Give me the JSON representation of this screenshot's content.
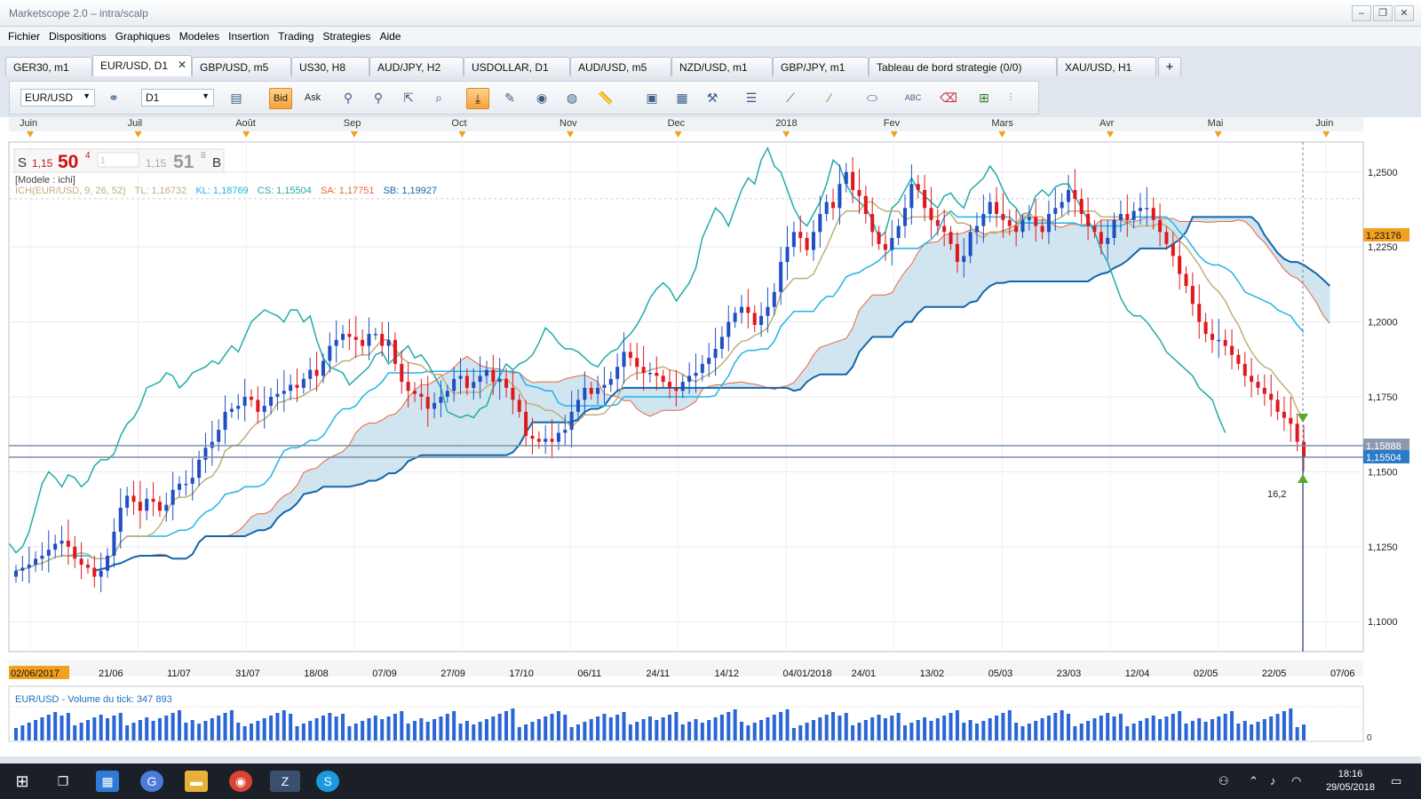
{
  "window": {
    "title": "Marketscope 2.0 – intra/scalp"
  },
  "menu": [
    "Fichier",
    "Dispositions",
    "Graphiques",
    "Modeles",
    "Insertion",
    "Trading",
    "Strategies",
    "Aide"
  ],
  "tabs": [
    {
      "label": "GER30, m1",
      "active": false
    },
    {
      "label": "EUR/USD, D1",
      "active": true
    },
    {
      "label": "GBP/USD, m5",
      "active": false
    },
    {
      "label": "US30, H8",
      "active": false
    },
    {
      "label": "AUD/JPY, H2",
      "active": false
    },
    {
      "label": "USDOLLAR, D1",
      "active": false
    },
    {
      "label": "AUD/USD, m5",
      "active": false
    },
    {
      "label": "NZD/USD, m1",
      "active": false
    },
    {
      "label": "GBP/JPY, m1",
      "active": false
    },
    {
      "label": "Tableau de bord strategie (0/0)",
      "active": false
    },
    {
      "label": "XAU/USD, H1",
      "active": false
    }
  ],
  "toolbar": {
    "symbol": "EUR/USD",
    "timeframe": "D1",
    "bid_label": "Bid",
    "ask_label": "Ask"
  },
  "quote": {
    "sell_letter": "S",
    "sell_prefix": "1,15",
    "sell_big": "50",
    "sell_sup": "4",
    "lots": "1",
    "buy_prefix": "1,15",
    "buy_big": "51",
    "buy_sup": "8",
    "buy_letter": "B"
  },
  "indicator": {
    "model": "[Modele : ichi]",
    "ich": "ICH(EUR/USD, 9, 26, 52)",
    "tl": "TL: 1,16732",
    "kl": "KL: 1,18769",
    "cs": "CS: 1,15504",
    "sa": "SA: 1,17751",
    "sb": "SB: 1,19927"
  },
  "months": [
    "Juin",
    "Juil",
    "Août",
    "Sep",
    "Oct",
    "Nov",
    "Dec",
    "2018",
    "Fev",
    "Mars",
    "Avr",
    "Mai",
    "Juin"
  ],
  "date_axis": [
    "02/06/2017",
    "21/06",
    "11/07",
    "31/07",
    "18/08",
    "07/09",
    "27/09",
    "17/10",
    "06/11",
    "24/11",
    "14/12",
    "04/01/2018",
    "24/01",
    "13/02",
    "05/03",
    "23/03",
    "12/04",
    "02/05",
    "22/05",
    "07/06"
  ],
  "price_axis": [
    "1,2500",
    "1,2250",
    "1,2000",
    "1,1750",
    "1,1500",
    "1,1250",
    "1,1000"
  ],
  "price_tags": {
    "cloud": "1,23176",
    "bid": "1,15888",
    "last": "1,15504"
  },
  "marker_value": "16,2",
  "volume": {
    "title": "EUR/USD - Volume du tick: 347 893",
    "axis_zero": "0"
  },
  "taskbar": {
    "time": "18:16",
    "date": "29/05/2018"
  },
  "colors": {
    "bull": "#1f4fc2",
    "bear": "#e0181e",
    "tenkan": "#bfae7a",
    "kijun": "#20b4e8",
    "chikou": "#20aca8",
    "span_a": "#e8643c",
    "span_b": "#1465a8",
    "cloud_bull": "#c9e0ef",
    "cloud_bear": "#f6d3c6"
  },
  "chart_data": {
    "type": "candlestick",
    "symbol": "EUR/USD",
    "timeframe": "D1",
    "ylim": [
      1.09,
      1.26
    ],
    "closes": [
      1.117,
      1.118,
      1.119,
      1.121,
      1.122,
      1.124,
      1.126,
      1.127,
      1.125,
      1.121,
      1.119,
      1.118,
      1.115,
      1.117,
      1.122,
      1.13,
      1.138,
      1.142,
      1.14,
      1.137,
      1.141,
      1.14,
      1.137,
      1.139,
      1.144,
      1.146,
      1.146,
      1.148,
      1.154,
      1.158,
      1.16,
      1.164,
      1.17,
      1.171,
      1.172,
      1.175,
      1.174,
      1.17,
      1.172,
      1.175,
      1.176,
      1.177,
      1.179,
      1.178,
      1.181,
      1.184,
      1.182,
      1.187,
      1.192,
      1.194,
      1.196,
      1.195,
      1.194,
      1.192,
      1.196,
      1.196,
      1.192,
      1.194,
      1.186,
      1.18,
      1.177,
      1.176,
      1.175,
      1.171,
      1.173,
      1.175,
      1.177,
      1.181,
      1.182,
      1.178,
      1.18,
      1.182,
      1.184,
      1.18,
      1.181,
      1.178,
      1.174,
      1.17,
      1.162,
      1.161,
      1.16,
      1.161,
      1.16,
      1.163,
      1.164,
      1.17,
      1.174,
      1.178,
      1.176,
      1.178,
      1.179,
      1.181,
      1.185,
      1.19,
      1.188,
      1.185,
      1.183,
      1.183,
      1.182,
      1.18,
      1.178,
      1.177,
      1.18,
      1.182,
      1.183,
      1.186,
      1.188,
      1.191,
      1.195,
      1.2,
      1.203,
      1.205,
      1.203,
      1.199,
      1.202,
      1.205,
      1.21,
      1.22,
      1.225,
      1.23,
      1.228,
      1.224,
      1.23,
      1.236,
      1.24,
      1.238,
      1.246,
      1.25,
      1.244,
      1.242,
      1.236,
      1.23,
      1.226,
      1.224,
      1.228,
      1.232,
      1.238,
      1.246,
      1.244,
      1.238,
      1.234,
      1.232,
      1.23,
      1.226,
      1.22,
      1.222,
      1.23,
      1.232,
      1.236,
      1.24,
      1.236,
      1.234,
      1.232,
      1.23,
      1.234,
      1.235,
      1.232,
      1.23,
      1.236,
      1.238,
      1.24,
      1.244,
      1.241,
      1.236,
      1.232,
      1.23,
      1.226,
      1.228,
      1.234,
      1.236,
      1.234,
      1.237,
      1.238,
      1.238,
      1.234,
      1.23,
      1.226,
      1.222,
      1.216,
      1.212,
      1.206,
      1.2,
      1.196,
      1.194,
      1.194,
      1.192,
      1.189,
      1.186,
      1.182,
      1.18,
      1.178,
      1.176,
      1.174,
      1.17,
      1.168,
      1.166,
      1.16,
      1.155
    ]
  }
}
